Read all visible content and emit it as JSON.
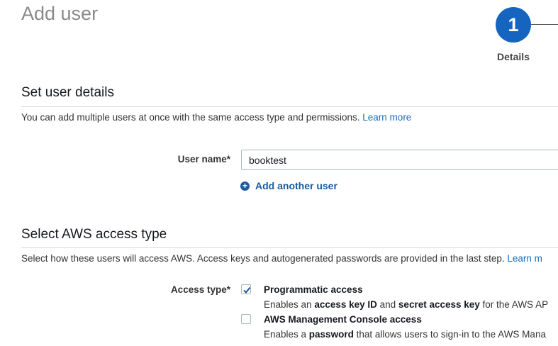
{
  "page": {
    "title": "Add user"
  },
  "wizard": {
    "current_step_number": "1",
    "current_step_label": "Details"
  },
  "user_details": {
    "title": "Set user details",
    "description": "You can add multiple users at once with the same access type and permissions.",
    "learn_more": "Learn more",
    "user_name_label": "User name*",
    "user_name_value": "booktest",
    "add_another_user": "Add another user"
  },
  "access_type": {
    "title": "Select AWS access type",
    "description": "Select how these users will access AWS. Access keys and autogenerated passwords are provided in the last step.",
    "learn_more": "Learn m",
    "label": "Access type*",
    "options": [
      {
        "title": "Programmatic access",
        "checked": true,
        "desc_1": "Enables an ",
        "desc_2": "access key ID",
        "desc_3": " and ",
        "desc_4": "secret access key",
        "desc_5": " for the AWS AP"
      },
      {
        "title": "AWS Management Console access",
        "checked": false,
        "desc_1": "Enables a ",
        "desc_2": "password",
        "desc_3": " that allows users to sign-in to the AWS Mana"
      }
    ]
  }
}
